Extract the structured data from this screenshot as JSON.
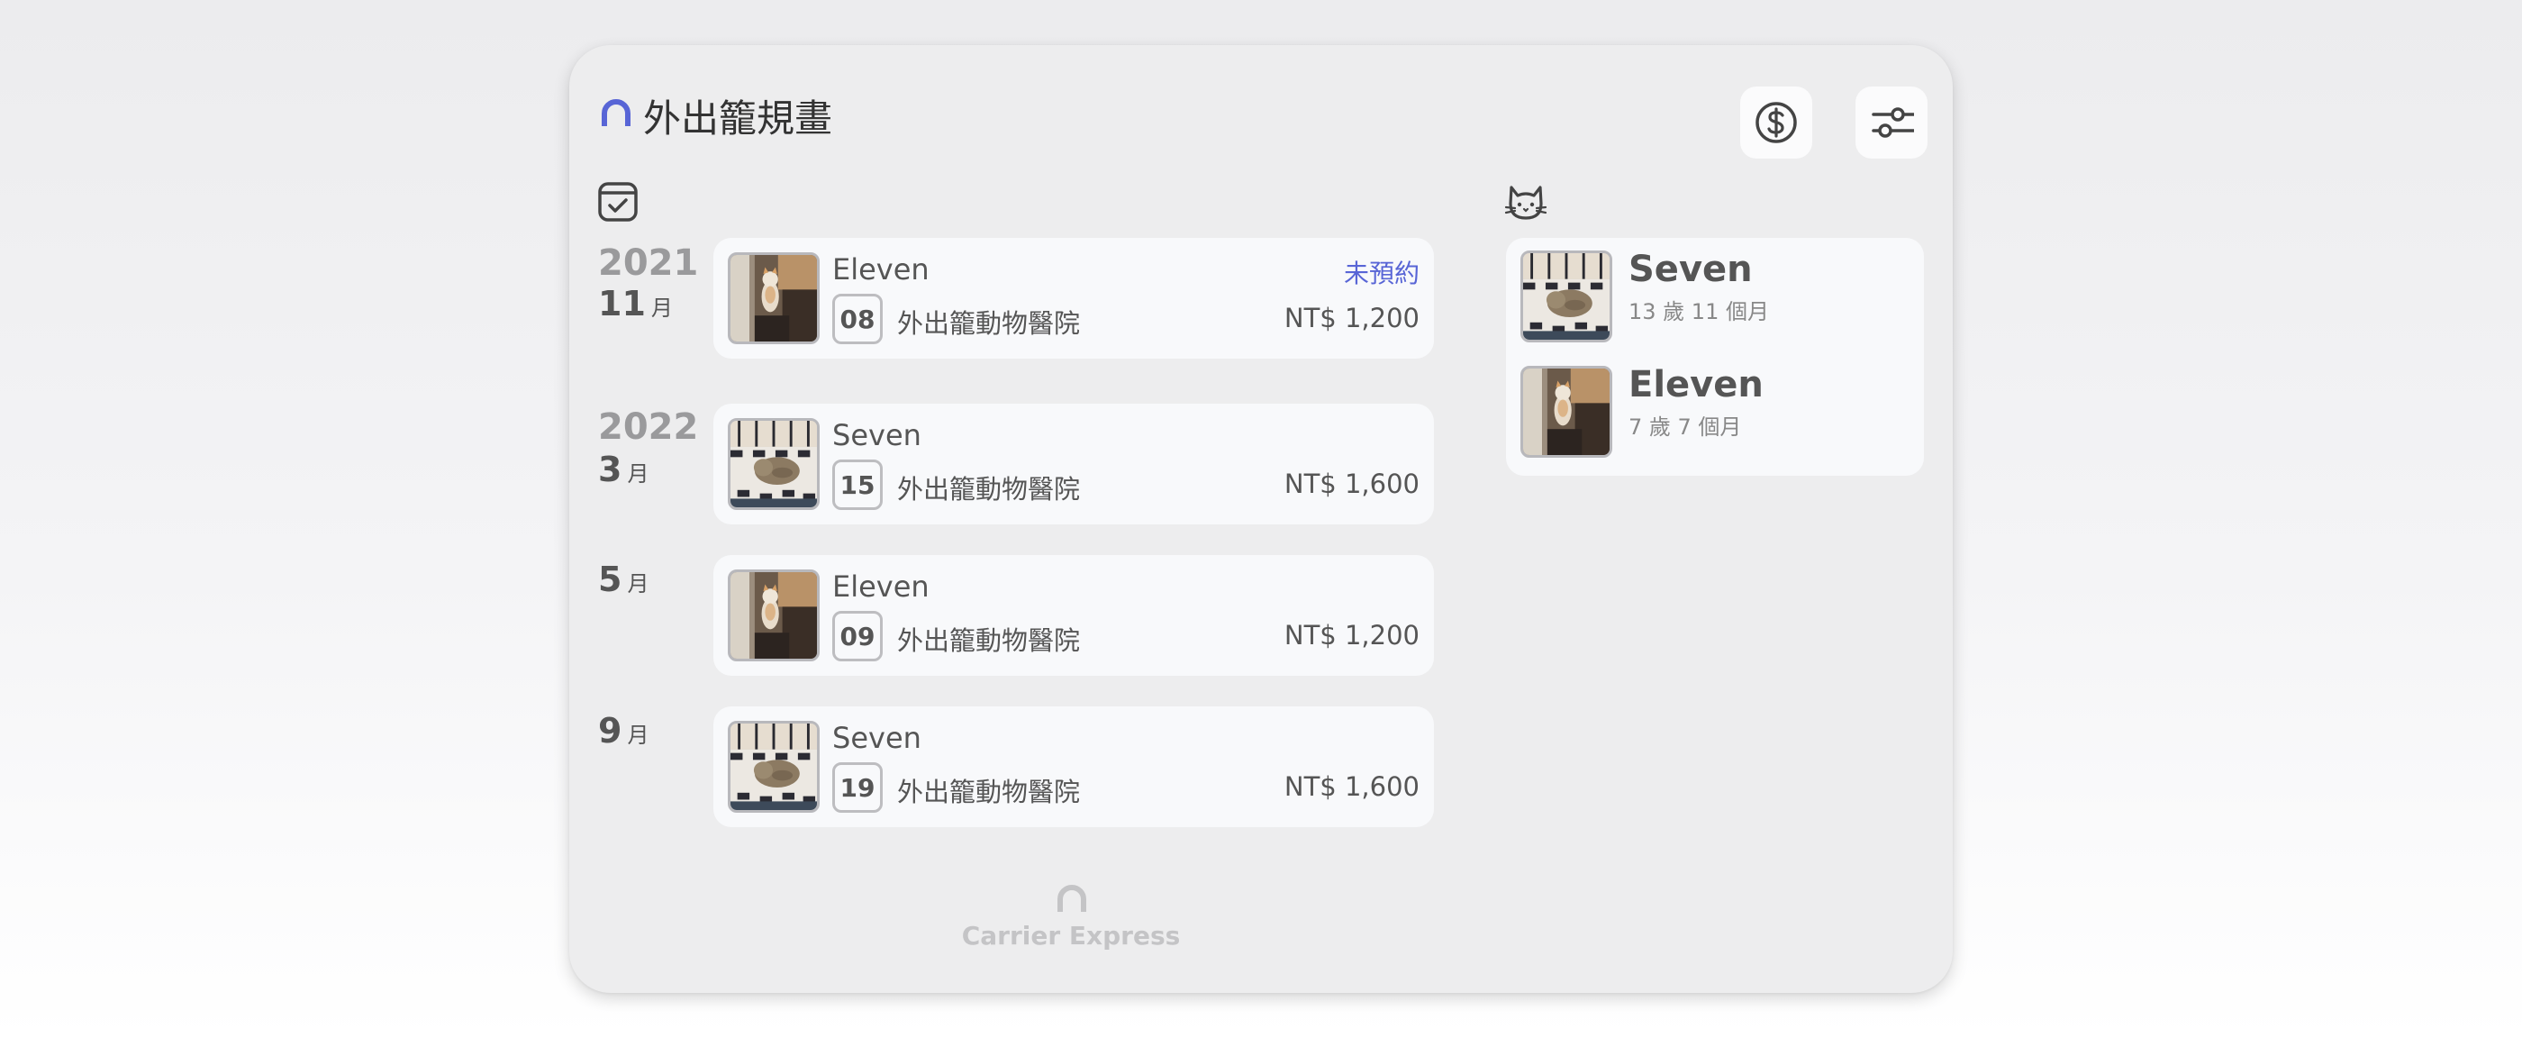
{
  "app": {
    "title": "外出籠規畫",
    "brand_color": "#5865d6",
    "footer_brand": "Carrier Express"
  },
  "header_buttons": [
    {
      "name": "money",
      "icon": "dollar-circle-icon"
    },
    {
      "name": "filter",
      "icon": "sliders-icon"
    }
  ],
  "sections": {
    "schedule_icon": "calendar-check-icon",
    "pets_icon": "cat-face-icon"
  },
  "schedule": {
    "years": {
      "y2021": "2021",
      "y2022": "2022"
    },
    "month_unit": "月",
    "months": {
      "m1": "11",
      "m2": "3",
      "m3": "5",
      "m4": "9"
    },
    "trips": [
      {
        "pet": "Eleven",
        "status": "未預約",
        "day": "08",
        "place": "外出籠動物醫院",
        "price": "NT$ 1,200"
      },
      {
        "pet": "Seven",
        "status": "",
        "day": "15",
        "place": "外出籠動物醫院",
        "price": "NT$ 1,600"
      },
      {
        "pet": "Eleven",
        "status": "",
        "day": "09",
        "place": "外出籠動物醫院",
        "price": "NT$ 1,200"
      },
      {
        "pet": "Seven",
        "status": "",
        "day": "19",
        "place": "外出籠動物醫院",
        "price": "NT$ 1,600"
      }
    ]
  },
  "pets": [
    {
      "name": "Seven",
      "age": "13 歲 11 個月"
    },
    {
      "name": "Eleven",
      "age": "7 歲 7 個月"
    }
  ]
}
